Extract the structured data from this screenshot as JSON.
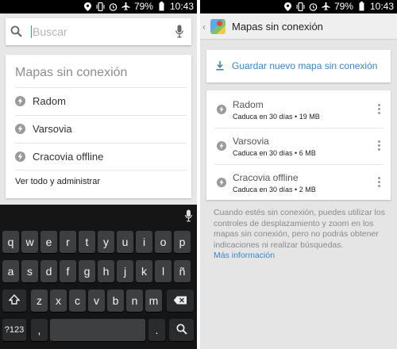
{
  "status_bar": {
    "battery": "79%",
    "time": "10:43"
  },
  "left": {
    "search": {
      "placeholder": "Buscar"
    },
    "offline_card": {
      "title": "Mapas sin conexión",
      "items": [
        "Radom",
        "Varsovia",
        "Cracovia offline"
      ],
      "manage_link": "Ver todo y administrar"
    },
    "keyboard": {
      "row1": [
        "q",
        "w",
        "e",
        "r",
        "t",
        "y",
        "u",
        "i",
        "o",
        "p"
      ],
      "row2": [
        "a",
        "s",
        "d",
        "f",
        "g",
        "h",
        "j",
        "k",
        "l",
        "ñ"
      ],
      "row3": [
        "z",
        "x",
        "c",
        "v",
        "b",
        "n",
        "m"
      ],
      "symbols_key": "?123",
      "comma": ",",
      "period": "."
    }
  },
  "right": {
    "title": "Mapas sin conexión",
    "save_label": "Guardar nuevo mapa sin conexión",
    "maps": [
      {
        "name": "Radom",
        "meta": "Caduca en 30 días  •  19 MB"
      },
      {
        "name": "Varsovia",
        "meta": "Caduca en 30 días  •  6 MB"
      },
      {
        "name": "Cracovia offline",
        "meta": "Caduca en 30 días  •  2 MB"
      }
    ],
    "info_text": "Cuando estés sin conexión, puedes utilizar los controles de desplazamiento y zoom en los mapas sin conexión, pero no podrás obtener indicaciones ni realizar búsquedas.",
    "more_link": "Más información"
  },
  "icons": {
    "status": [
      "location-icon",
      "vibrate-icon",
      "alarm-icon",
      "airplane-icon",
      "battery-icon"
    ],
    "search": "search-icon",
    "mic": "mic-icon",
    "bolt": "bolt-icon",
    "download": "download-icon",
    "overflow": "overflow-menu-icon"
  },
  "colors": {
    "accent": "#3b86c9",
    "keyboard_bg": "#151515",
    "key": "#3e3f41"
  }
}
